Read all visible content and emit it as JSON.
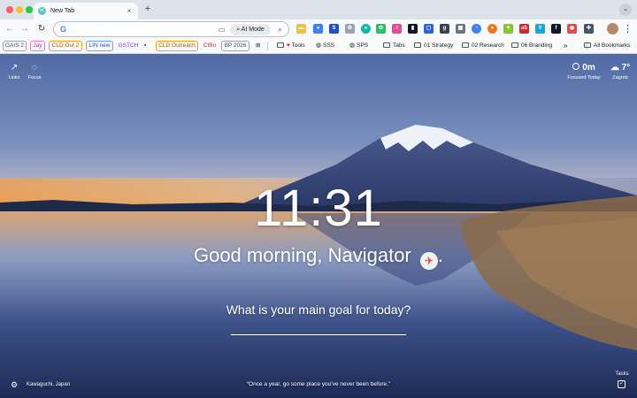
{
  "tab": {
    "title": "New Tab",
    "favicon": "momentum-icon"
  },
  "toolbar": {
    "ai_mode_label": "AI Mode",
    "search_placeholder": ""
  },
  "bookmarks": {
    "chips": [
      {
        "label": "GAIS 2",
        "color": "#6b7280"
      },
      {
        "label": "Jay",
        "color": "#d946a8"
      },
      {
        "label": "CLD Out 2",
        "color": "#c2410c"
      },
      {
        "label": "LIN new",
        "color": "#2563eb"
      },
      {
        "label": "GSTCH",
        "color": "#7c3aed"
      },
      {
        "label": "CLD Outreach",
        "color": "#c2410c"
      },
      {
        "label": "CIBo",
        "color": "#dc2626"
      },
      {
        "label": "BP 2026",
        "color": "#6b7280"
      }
    ],
    "links": [
      {
        "label": "Tools",
        "icon": "heart-icon"
      },
      {
        "label": "SSS",
        "icon": "globe-icon"
      },
      {
        "label": "SPS",
        "icon": "globe-icon"
      },
      {
        "label": "Tabs",
        "icon": "folder-icon"
      },
      {
        "label": "01 Strategy",
        "icon": "folder-icon"
      },
      {
        "label": "02 Research",
        "icon": "folder-icon"
      },
      {
        "label": "06 Branding",
        "icon": "folder-icon"
      }
    ],
    "more": "»",
    "all_bookmarks": "All Bookmarks"
  },
  "dashboard": {
    "links_label": "Links",
    "focus_label": "Focus",
    "focused_today_value": "0m",
    "focused_today_label": "Focused Today",
    "temperature": "7°",
    "city": "Zagreb",
    "clock": "11:31",
    "greeting": "Good morning, Navigator",
    "greeting_end": ".",
    "goal_question": "What is your main goal for today?",
    "goal_value": "",
    "location": "Kawaguchi, Japan",
    "quote": "“Once a year, go some place you’ve never been before.”",
    "tasks_label": "Tasks"
  }
}
